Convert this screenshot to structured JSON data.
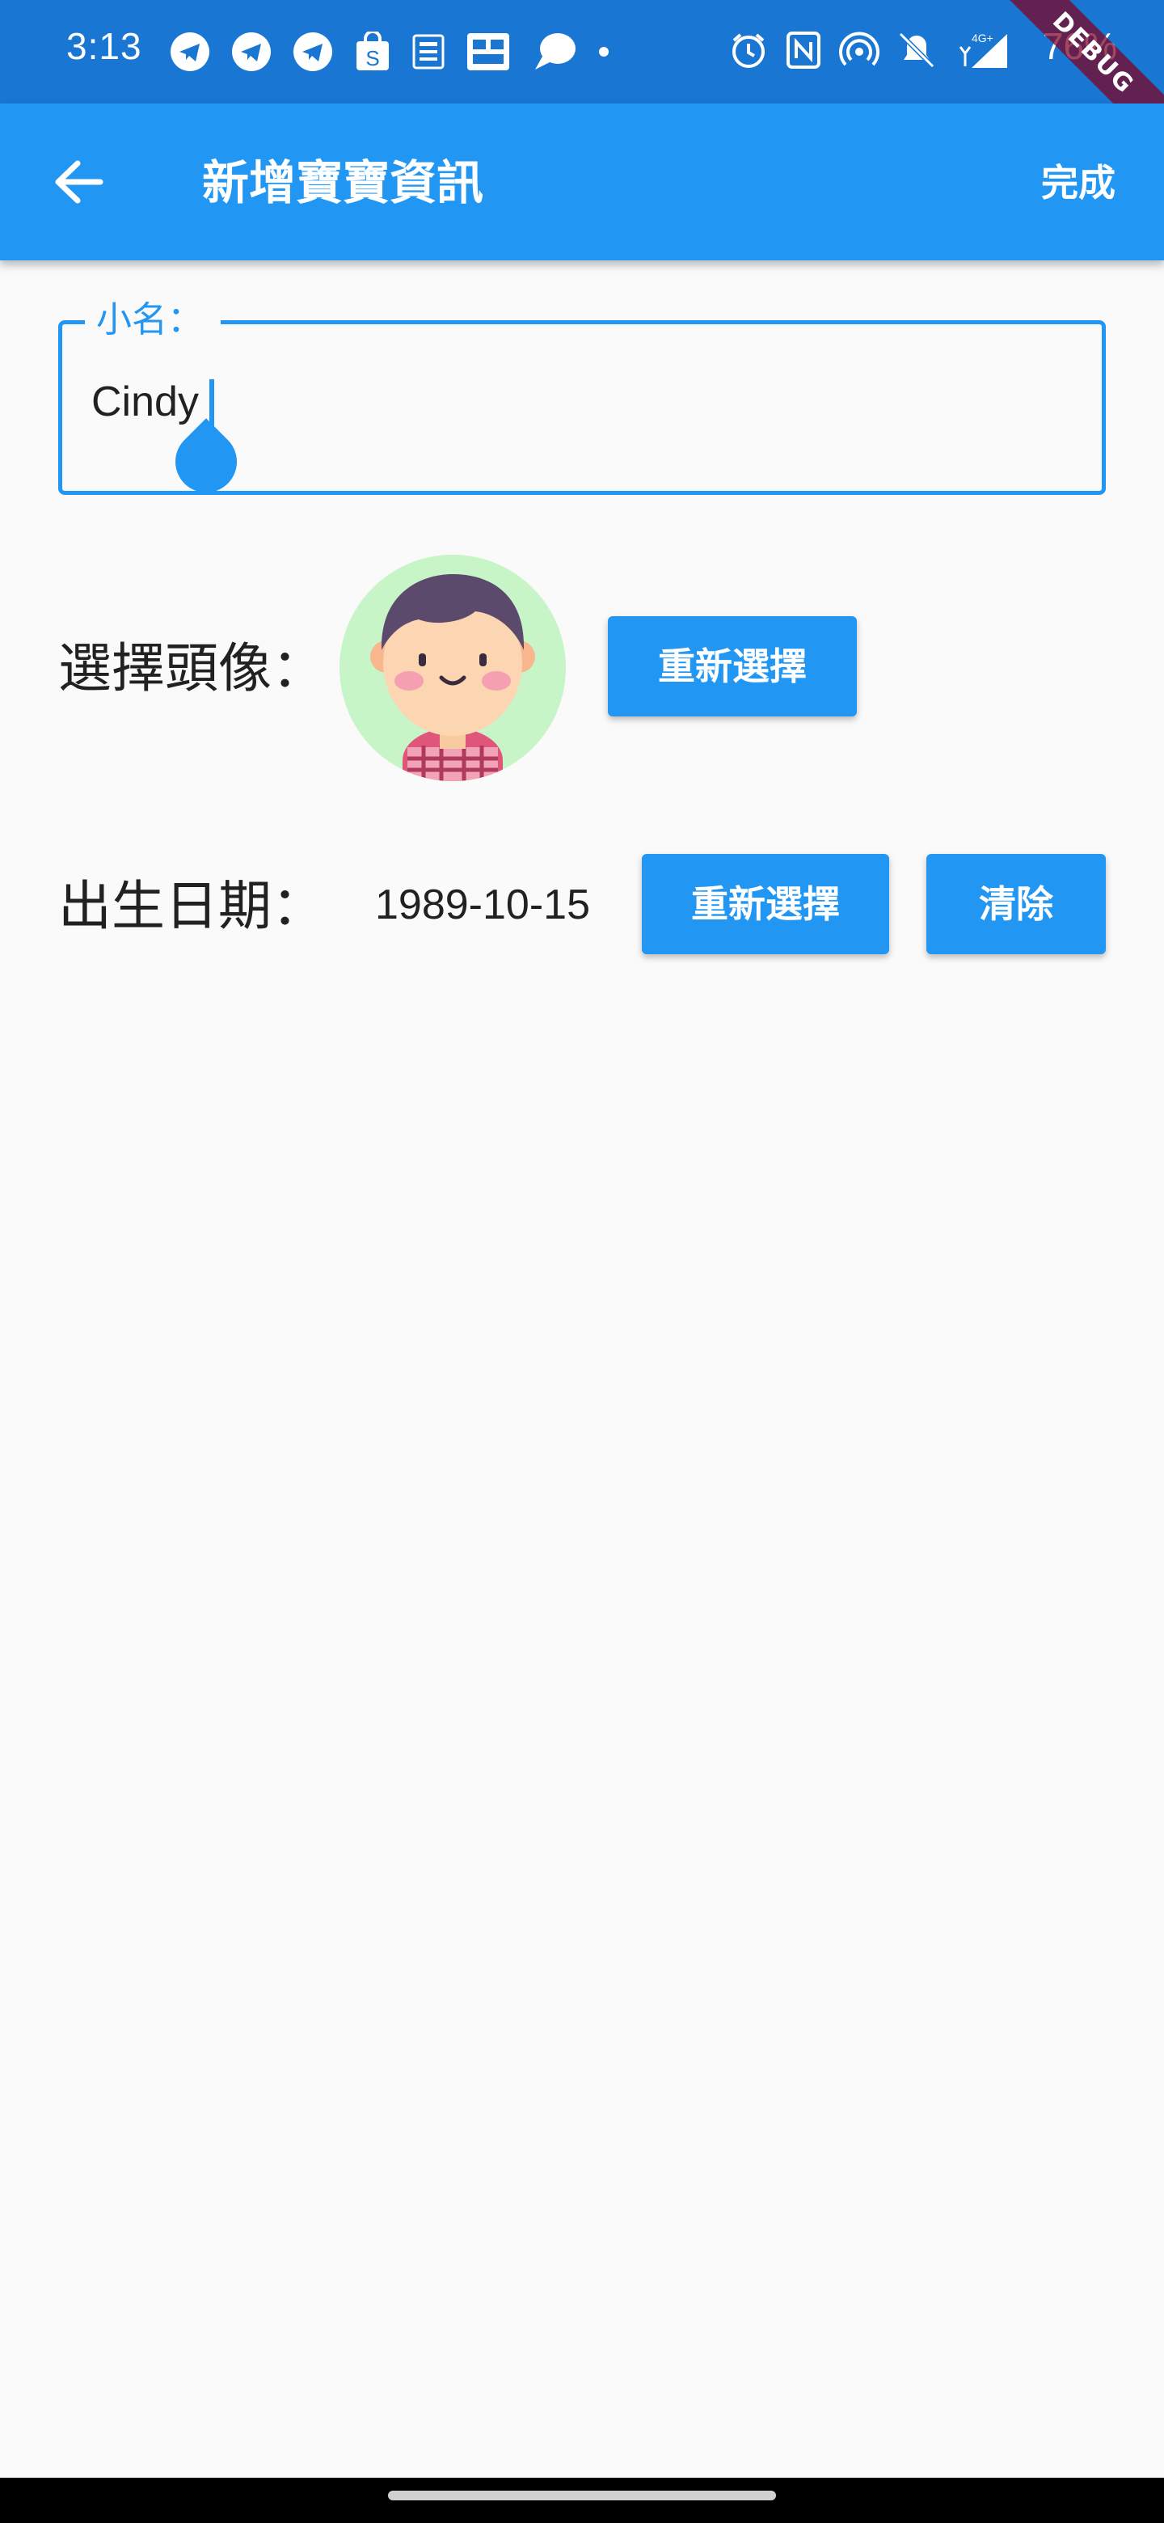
{
  "status_bar": {
    "time": "3:13",
    "battery": "76%",
    "network": "4G+",
    "left_icons": [
      "telegram-icon",
      "telegram-icon",
      "telegram-icon",
      "shopping-bag-icon",
      "news-icon",
      "app-icon",
      "chat-bubble-icon",
      "dot-icon"
    ],
    "right_icons": [
      "alarm-icon",
      "nfc-icon",
      "hotspot-icon",
      "mute-icon",
      "signal-icon"
    ],
    "debug_banner": "DEBUG",
    "background_color": "#1976d2"
  },
  "app_bar": {
    "title": "新增寶寶資訊",
    "done_label": "完成",
    "back_icon": "arrow-left-icon",
    "background_color": "#2196f3"
  },
  "form": {
    "name_label": "小名：",
    "name_value": "Cindy",
    "avatar_label": "選擇頭像：",
    "avatar_reselect_label": "重新選擇",
    "birth_label": "出生日期：",
    "birth_value": "1989-10-15",
    "birth_reselect_label": "重新選擇",
    "birth_clear_label": "清除"
  },
  "colors": {
    "accent": "#2196f3",
    "avatar_bg": "#c8f5c8",
    "page_bg": "#fafafa"
  }
}
